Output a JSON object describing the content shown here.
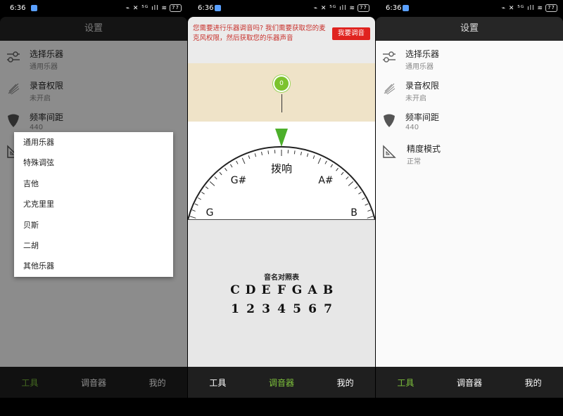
{
  "status": {
    "time": "6:36",
    "icons": "⌁ ✕ ⁵ᴳ ıll ≋",
    "battery": "77"
  },
  "settings": {
    "title": "设置",
    "items": [
      {
        "title": "选择乐器",
        "sub": "通用乐器",
        "icon": "sliders-icon"
      },
      {
        "title": "录音权限",
        "sub": "未开启",
        "icon": "feather-icon"
      },
      {
        "title": "频率间距",
        "sub": "440",
        "icon": "guitar-pick-icon"
      },
      {
        "title": "精度模式",
        "sub": "正常",
        "icon": "set-square-icon"
      }
    ]
  },
  "dropdown": {
    "options": [
      "通用乐器",
      "特殊调弦",
      "吉他",
      "尤克里里",
      "贝斯",
      "二胡",
      "其他乐器"
    ]
  },
  "nav": {
    "tools": "工具",
    "tuner": "调音器",
    "mine": "我的"
  },
  "tuner": {
    "notice": "您需要进行乐器调音吗? 我们需要获取您的麦克风权限，然后获取您的乐器声音",
    "notice_button": "我要调音",
    "pin_value": "0",
    "dial": {
      "center": "拨响",
      "left1": "G#",
      "right1": "A#",
      "left2": "G",
      "right2": "B"
    },
    "ref_title": "音名对照表",
    "letters": [
      "C",
      "D",
      "E",
      "F",
      "G",
      "A",
      "B"
    ],
    "numbers": [
      "1",
      "2",
      "3",
      "4",
      "5",
      "6",
      "7"
    ]
  },
  "colors": {
    "accent_green": "#7ec23c",
    "alert_red": "#e0231f"
  }
}
